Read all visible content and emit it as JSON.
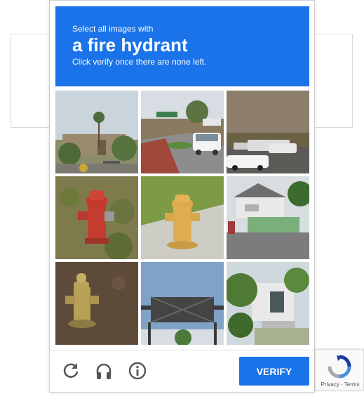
{
  "challenge": {
    "prompt_small": "Select all images with",
    "prompt_target": "a fire hydrant",
    "prompt_instruction": "Click verify once there are none left."
  },
  "tiles": [
    {
      "row": 1,
      "col": 1,
      "content": "palm trees and building"
    },
    {
      "row": 1,
      "col": 2,
      "content": "street with white car"
    },
    {
      "row": 1,
      "col": 3,
      "content": "parking lot with cars"
    },
    {
      "row": 2,
      "col": 1,
      "content": "red fire hydrant"
    },
    {
      "row": 2,
      "col": 2,
      "content": "yellow fire hydrant"
    },
    {
      "row": 2,
      "col": 3,
      "content": "house with green fence"
    },
    {
      "row": 3,
      "col": 1,
      "content": "yellow fire hydrant"
    },
    {
      "row": 3,
      "col": 2,
      "content": "highway sign"
    },
    {
      "row": 3,
      "col": 3,
      "content": "house with trees"
    }
  ],
  "footer": {
    "reload_icon": "reload-icon",
    "audio_icon": "headphones-icon",
    "info_icon": "info-icon",
    "verify_label": "VERIFY"
  },
  "badge": {
    "text": "Privacy - Terms"
  },
  "colors": {
    "accent": "#1a73e8",
    "icon": "#555555"
  }
}
